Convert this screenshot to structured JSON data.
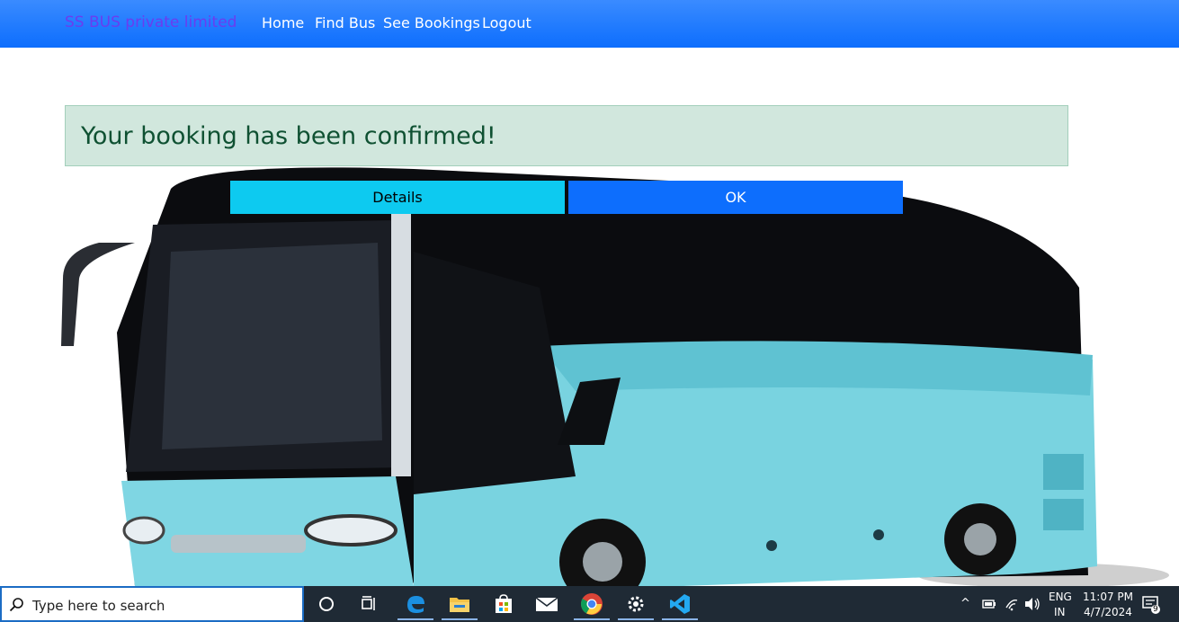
{
  "navbar": {
    "brand": "SS BUS private limited",
    "links": [
      "Home",
      "Find Bus",
      "See Bookings",
      "Logout"
    ]
  },
  "alert": {
    "message": "Your booking has been confirmed!"
  },
  "buttons": {
    "details": "Details",
    "ok": "OK"
  },
  "taskbar": {
    "search_placeholder": "Type here to search",
    "apps": [
      "cortana-icon",
      "task-view-icon",
      "edge-icon",
      "file-explorer-icon",
      "store-icon",
      "mail-icon",
      "chrome-icon",
      "settings-icon",
      "vscode-icon"
    ],
    "tray": {
      "lang_top": "ENG",
      "lang_bottom": "IN",
      "time": "11:07 PM",
      "date": "4/7/2024",
      "notifications": "9"
    }
  },
  "colors": {
    "navbar": "#0d6efd",
    "alert_bg": "#d1e7dd",
    "alert_text": "#0f5132",
    "details_btn": "#0dcaf0",
    "ok_btn": "#0d6efd",
    "taskbar": "#1f2a35"
  }
}
